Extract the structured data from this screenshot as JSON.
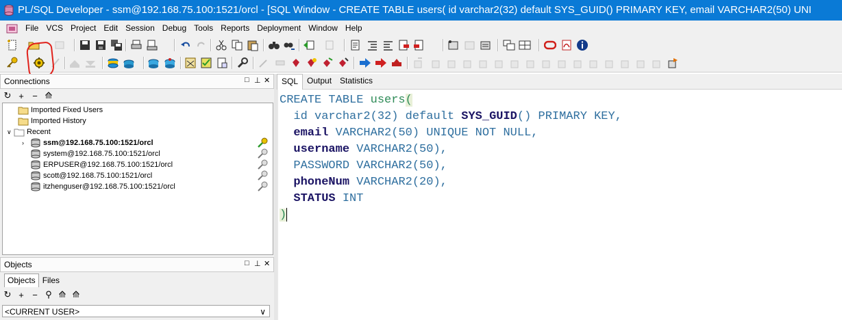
{
  "window": {
    "title": "PL/SQL Developer - ssm@192.168.75.100:1521/orcl - [SQL Window - CREATE TABLE users( id varchar2(32) default SYS_GUID() PRIMARY KEY, email VARCHAR2(50) UNI"
  },
  "menu": {
    "items": [
      "File",
      "VCS",
      "Project",
      "Edit",
      "Session",
      "Debug",
      "Tools",
      "Reports",
      "Deployment",
      "Window",
      "Help"
    ]
  },
  "connections": {
    "title": "Connections",
    "tree": [
      {
        "label": "Imported Fixed Users"
      },
      {
        "label": "Imported History"
      },
      {
        "label": "Recent"
      },
      {
        "label": "ssm@192.168.75.100:1521/orcl"
      },
      {
        "label": "system@192.168.75.100:1521/orcl"
      },
      {
        "label": "ERPUSER@192.168.75.100:1521/orcl"
      },
      {
        "label": "scott@192.168.75.100:1521/orcl"
      },
      {
        "label": "itzhenguser@192.168.75.100:1521/orcl"
      }
    ]
  },
  "objects": {
    "title": "Objects",
    "tabs": [
      "Objects",
      "Files"
    ],
    "user_select": "<CURRENT USER>"
  },
  "editor": {
    "tabs": [
      "SQL",
      "Output",
      "Statistics"
    ],
    "code": {
      "l1_kw": "CREATE TABLE",
      "l1_name": "users",
      "l1_paren": "(",
      "l2_col": "id",
      "l2_type": "varchar2(32)",
      "l2_default": "default",
      "l2_func": "SYS_GUID",
      "l2_rest": "() PRIMARY KEY,",
      "l3_col": "email",
      "l3_rest": "VARCHAR2(50) UNIQUE NOT NULL,",
      "l4_col": "username",
      "l4_rest": "VARCHAR2(50),",
      "l5_line": "PASSWORD VARCHAR2(50),",
      "l6_col": "phoneNum",
      "l6_rest": "VARCHAR2(20),",
      "l7_col": "STATUS",
      "l7_rest": "INT",
      "l8_paren": ")"
    }
  },
  "colors": {
    "titlebar": "#0a7ad6",
    "highlight_circle": "#e0201a",
    "keyword": "#2f6f9f",
    "table_name": "#2e8b57",
    "bold_identifier": "#1b1464"
  }
}
